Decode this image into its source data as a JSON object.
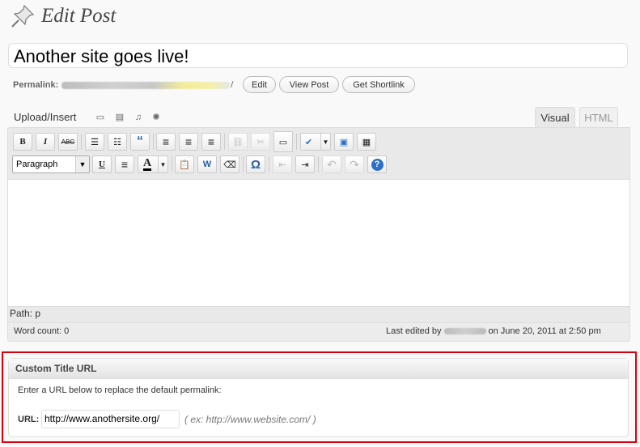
{
  "header": {
    "title": "Edit Post",
    "icon": "pushpin-icon"
  },
  "post": {
    "title_value": "Another site goes live!",
    "permalink_label": "Permalink:",
    "permalink_slash": "/",
    "buttons": {
      "edit": "Edit",
      "view": "View Post",
      "shortlink": "Get Shortlink"
    }
  },
  "media": {
    "label": "Upload/Insert",
    "icons": [
      "image-icon",
      "video-icon",
      "audio-icon",
      "media-icon"
    ]
  },
  "editor": {
    "tabs": {
      "visual": "Visual",
      "html": "HTML"
    },
    "active_tab": "Visual",
    "toolbar1": [
      {
        "name": "bold",
        "glyph": "B"
      },
      {
        "name": "italic",
        "glyph": "I"
      },
      {
        "name": "strikethrough",
        "glyph": "ABC"
      },
      {
        "name": "bullet-list",
        "glyph": "☰"
      },
      {
        "name": "numbered-list",
        "glyph": "☷"
      },
      {
        "name": "blockquote",
        "glyph": "“"
      },
      {
        "name": "align-left",
        "glyph": "≡"
      },
      {
        "name": "align-center",
        "glyph": "≡"
      },
      {
        "name": "align-right",
        "glyph": "≡"
      },
      {
        "name": "insert-link",
        "glyph": "⛓"
      },
      {
        "name": "unlink",
        "glyph": "✂"
      },
      {
        "name": "insert-more",
        "glyph": "▭"
      },
      {
        "name": "spellcheck",
        "glyph": "✔"
      },
      {
        "name": "fullscreen",
        "glyph": "▣"
      },
      {
        "name": "kitchen-sink",
        "glyph": "▦"
      }
    ],
    "format_select": "Paragraph",
    "toolbar2": [
      {
        "name": "underline",
        "glyph": "U"
      },
      {
        "name": "justify",
        "glyph": "≡"
      },
      {
        "name": "text-color",
        "glyph": "A"
      },
      {
        "name": "paste-text",
        "glyph": "📋"
      },
      {
        "name": "paste-word",
        "glyph": "W"
      },
      {
        "name": "remove-format",
        "glyph": "⌫"
      },
      {
        "name": "special-char",
        "glyph": "Ω"
      },
      {
        "name": "outdent",
        "glyph": "⇤"
      },
      {
        "name": "indent",
        "glyph": "⇥"
      },
      {
        "name": "undo",
        "glyph": "↶"
      },
      {
        "name": "redo",
        "glyph": "↷"
      },
      {
        "name": "help",
        "glyph": "?"
      }
    ],
    "path": "Path: p",
    "word_count": "Word count: 0",
    "last_edited_prefix": "Last edited by",
    "last_edited_suffix": "on June 20, 2011 at 2:50 pm"
  },
  "custom_url_box": {
    "title": "Custom Title URL",
    "description": "Enter a URL below to replace the default permalink:",
    "url_label": "URL:",
    "url_value": "http://www.anothersite.org/",
    "example": "( ex: http://www.website.com/ )"
  },
  "colors": {
    "highlight_border": "#d9000d",
    "help_button": "#2a6fc9"
  }
}
